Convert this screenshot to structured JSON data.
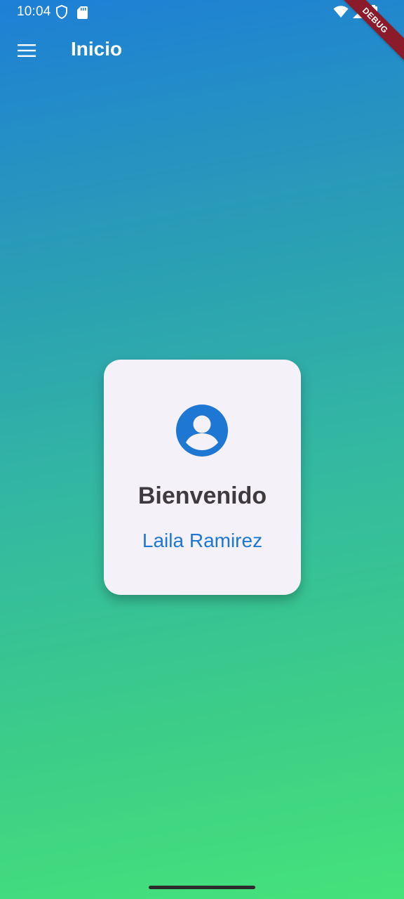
{
  "status_bar": {
    "time": "10:04",
    "icons_left": [
      "shield-icon",
      "sd-card-icon"
    ],
    "icons_right": [
      "wifi-icon",
      "signal-icon",
      "battery-icon"
    ]
  },
  "debug_ribbon": {
    "label": "DEBUG",
    "color": "#8b1a2b"
  },
  "app_bar": {
    "menu_icon": "hamburger-menu-icon",
    "title": "Inicio"
  },
  "card": {
    "avatar_icon": "account-circle-icon",
    "title": "Bienvenido",
    "user_name": "Laila Ramirez",
    "accent_color": "#1e77d3",
    "background_color": "#f5f1f9"
  },
  "background": {
    "gradient_start": "#1e7fd6",
    "gradient_end": "#45e27a"
  }
}
